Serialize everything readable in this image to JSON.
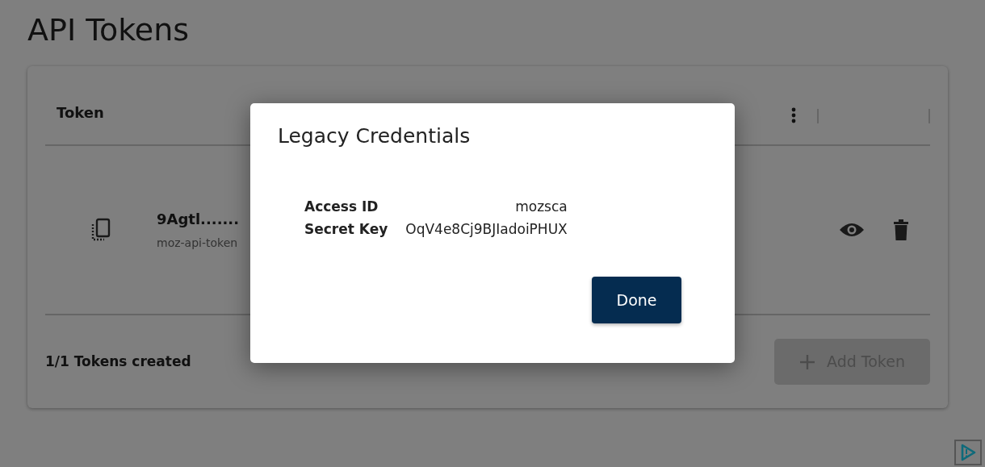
{
  "page": {
    "title": "API Tokens"
  },
  "table": {
    "columns": [
      "Token"
    ],
    "rows": [
      {
        "token": "9Agtl.......",
        "name": "moz-api-token"
      }
    ]
  },
  "footer": {
    "count": "1/1 Tokens created",
    "add_button": {
      "label": "Add Token",
      "disabled": true
    }
  },
  "dialog": {
    "title": "Legacy Credentials",
    "fields": [
      {
        "label": "Access ID",
        "value": "mozsca"
      },
      {
        "label": "Secret Key",
        "value": "OqV4e8Cj9BJIadoiPHUX"
      }
    ],
    "button": "Done"
  }
}
